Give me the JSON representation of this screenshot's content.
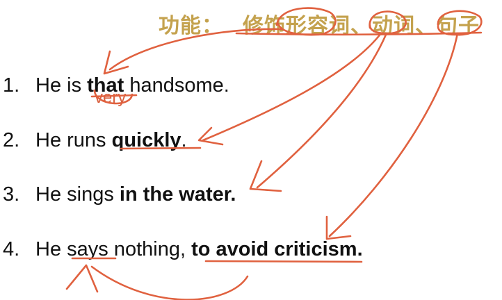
{
  "heading": {
    "label": "功能：",
    "content": "修饰形容词、动词、句子"
  },
  "sentences": [
    {
      "number": "1.",
      "before": "He is ",
      "bold": "that",
      "after": " handsome."
    },
    {
      "number": "2.",
      "before": "He runs ",
      "bold": "quickly",
      "after": "."
    },
    {
      "number": "3.",
      "before": "He sings ",
      "bold": "in the water.",
      "after": ""
    },
    {
      "number": "4.",
      "before": "He says nothing, ",
      "bold": "to avoid criticism.",
      "after": ""
    }
  ],
  "annotation": {
    "handwritten_word": "very"
  },
  "colors": {
    "heading": "#c4a24e",
    "ink": "#e0613f",
    "text": "#111111"
  }
}
